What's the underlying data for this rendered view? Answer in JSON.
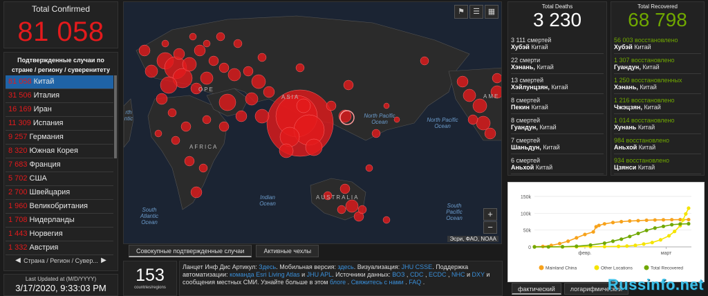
{
  "total": {
    "title": "Total Confirmed",
    "value": "81 058"
  },
  "list": {
    "header": "Подтвержденные случаи по стране / региону / суверенитету",
    "items": [
      {
        "n": "81 058",
        "c": "Китай"
      },
      {
        "n": "31 506",
        "c": "Италия"
      },
      {
        "n": "16 169",
        "c": "Иран"
      },
      {
        "n": "11 309",
        "c": "Испания"
      },
      {
        "n": "9 257",
        "c": "Германия"
      },
      {
        "n": "8 320",
        "c": "Южная Корея"
      },
      {
        "n": "7 683",
        "c": "Франция"
      },
      {
        "n": "5 702",
        "c": "США"
      },
      {
        "n": "2 700",
        "c": "Швейцария"
      },
      {
        "n": "1 960",
        "c": "Великобритания"
      },
      {
        "n": "1 708",
        "c": "Нидерланды"
      },
      {
        "n": "1 443",
        "c": "Норвегия"
      },
      {
        "n": "1 332",
        "c": "Австрия"
      }
    ],
    "pager": "Страна / Регион / Сувер...",
    "prev": "◀",
    "next": "▶"
  },
  "updated": {
    "label": "Last Updated at (M/D/YYYY)",
    "value": "3/17/2020, 9:33:03 PM"
  },
  "map": {
    "labels": {
      "north_pacific_1": "North Pacific Ocean",
      "north_pacific_2": "North Pacific Ocean",
      "indian": "Indian Ocean",
      "south_atlantic": "South Atlantic Ocean",
      "south_pacific": "South Pacific Ocean",
      "africa": "AFRICA",
      "asia": "ASIA",
      "australia": "AUSTRALIA",
      "europe": "OPE",
      "america": "AME",
      "north_atl": "rth ntic"
    },
    "attribution": "Эсри, ФАО, NOAA",
    "zoom_in": "+",
    "zoom_out": "−",
    "tabs": [
      "Совокупные подтвержденные случаи",
      "Активные чехлы"
    ]
  },
  "count": {
    "value": "153",
    "label": "countries/regions"
  },
  "info": {
    "t1": "Ланцет Инф Дис Артикул: ",
    "l1": "Здесь",
    "t2": ". Мобильная версия: ",
    "l2": "здесь",
    "t3": ". Визуализация: ",
    "l3": "JHU CSSE",
    "t4": ". Поддержка автоматизации: ",
    "l4": "команда Esri Living Atlas",
    "t5": " и ",
    "l5": "JHU APL",
    "t6": ". Источники данных: ",
    "l6": "ВОЗ",
    "t7": " , ",
    "l7": "CDC",
    "t8": " , ",
    "l8": "ECDC",
    "t9": " , ",
    "l9": "NHC",
    "t10": " и ",
    "l10": "DXY",
    "t11": " и сообщения местных СМИ. Узнайте больше в этом ",
    "l11": "блоге",
    "t12": " . ",
    "l12": "Свяжитесь с нами",
    "t13": " . ",
    "l13": "FAQ",
    "t14": " ."
  },
  "deaths": {
    "title": "Total Deaths",
    "value": "3 230",
    "items": [
      {
        "n": "3 111",
        "w": "смертей",
        "r": "Хубэй",
        "c": "Китай"
      },
      {
        "n": "22",
        "w": "смерти",
        "r": "Хэнань,",
        "c": "Китай"
      },
      {
        "n": "13",
        "w": "смертей",
        "r": "Хэйлунцзян,",
        "c": "Китай"
      },
      {
        "n": "8",
        "w": "смертей",
        "r": "Пекин",
        "c": "Китай"
      },
      {
        "n": "8",
        "w": "смертей",
        "r": "Гуандун,",
        "c": "Китай"
      },
      {
        "n": "7",
        "w": "смертей",
        "r": "Шаньдун,",
        "c": "Китай"
      },
      {
        "n": "6",
        "w": "смертей",
        "r": "Аньхой",
        "c": "Китай"
      }
    ]
  },
  "recovered": {
    "title": "Total Recovered",
    "value": "68 798",
    "items": [
      {
        "n": "56 003",
        "w": "восстановлено",
        "r": "Хубэй",
        "c": "Китай"
      },
      {
        "n": "1 307",
        "w": "восстановлено",
        "r": "Гуандун,",
        "c": "Китай"
      },
      {
        "n": "1 250",
        "w": "восстановленных",
        "r": "Хэнань,",
        "c": "Китай"
      },
      {
        "n": "1 216",
        "w": "восстановлено",
        "r": "Чжэцзян,",
        "c": "Китай"
      },
      {
        "n": "1 014",
        "w": "восстановлено",
        "r": "Хунань",
        "c": "Китай"
      },
      {
        "n": "984",
        "w": "восстановлено",
        "r": "Аньхой",
        "c": "Китай"
      },
      {
        "n": "934",
        "w": "восстановлено",
        "r": "Цзянси",
        "c": "Китай"
      }
    ]
  },
  "chart_data": {
    "type": "line",
    "ytick_labels": [
      "0",
      "50k",
      "100k",
      "150k"
    ],
    "ylim": [
      0,
      150000
    ],
    "xtick_labels": [
      "февр.",
      "март"
    ],
    "xlim": [
      0,
      56
    ],
    "legend": [
      "Mainland China",
      "Other Locations",
      "Total Recovered"
    ],
    "legend_position": "bottom",
    "colors": [
      "#f7a21b",
      "#f5e400",
      "#70a800"
    ],
    "series": [
      {
        "name": "Mainland China",
        "x": [
          0,
          3,
          6,
          9,
          12,
          15,
          18,
          21,
          22,
          23,
          25,
          28,
          31,
          34,
          37,
          40,
          43,
          46,
          49,
          52,
          55
        ],
        "values": [
          550,
          1300,
          4500,
          9700,
          17000,
          27000,
          37000,
          44600,
          59800,
          63800,
          68500,
          72400,
          75000,
          77000,
          78000,
          79200,
          80000,
          80500,
          80800,
          81000,
          81058
        ]
      },
      {
        "name": "Other Locations",
        "x": [
          0,
          5,
          10,
          15,
          20,
          25,
          30,
          33,
          36,
          39,
          42,
          45,
          48,
          50,
          52,
          53,
          54,
          55
        ],
        "values": [
          20,
          80,
          200,
          400,
          600,
          900,
          1500,
          2500,
          4600,
          8500,
          13000,
          21000,
          33000,
          46000,
          63000,
          80000,
          98000,
          115000
        ]
      },
      {
        "name": "Total Recovered",
        "x": [
          0,
          5,
          10,
          15,
          20,
          25,
          28,
          31,
          34,
          37,
          40,
          43,
          46,
          49,
          52,
          55
        ],
        "values": [
          30,
          100,
          500,
          2000,
          5500,
          11000,
          17000,
          23000,
          31000,
          40000,
          49000,
          56000,
          61000,
          66000,
          68000,
          68798
        ]
      }
    ]
  },
  "chart_tabs": [
    "фактический",
    "логарифмический"
  ],
  "watermark": "Russinfo.net"
}
